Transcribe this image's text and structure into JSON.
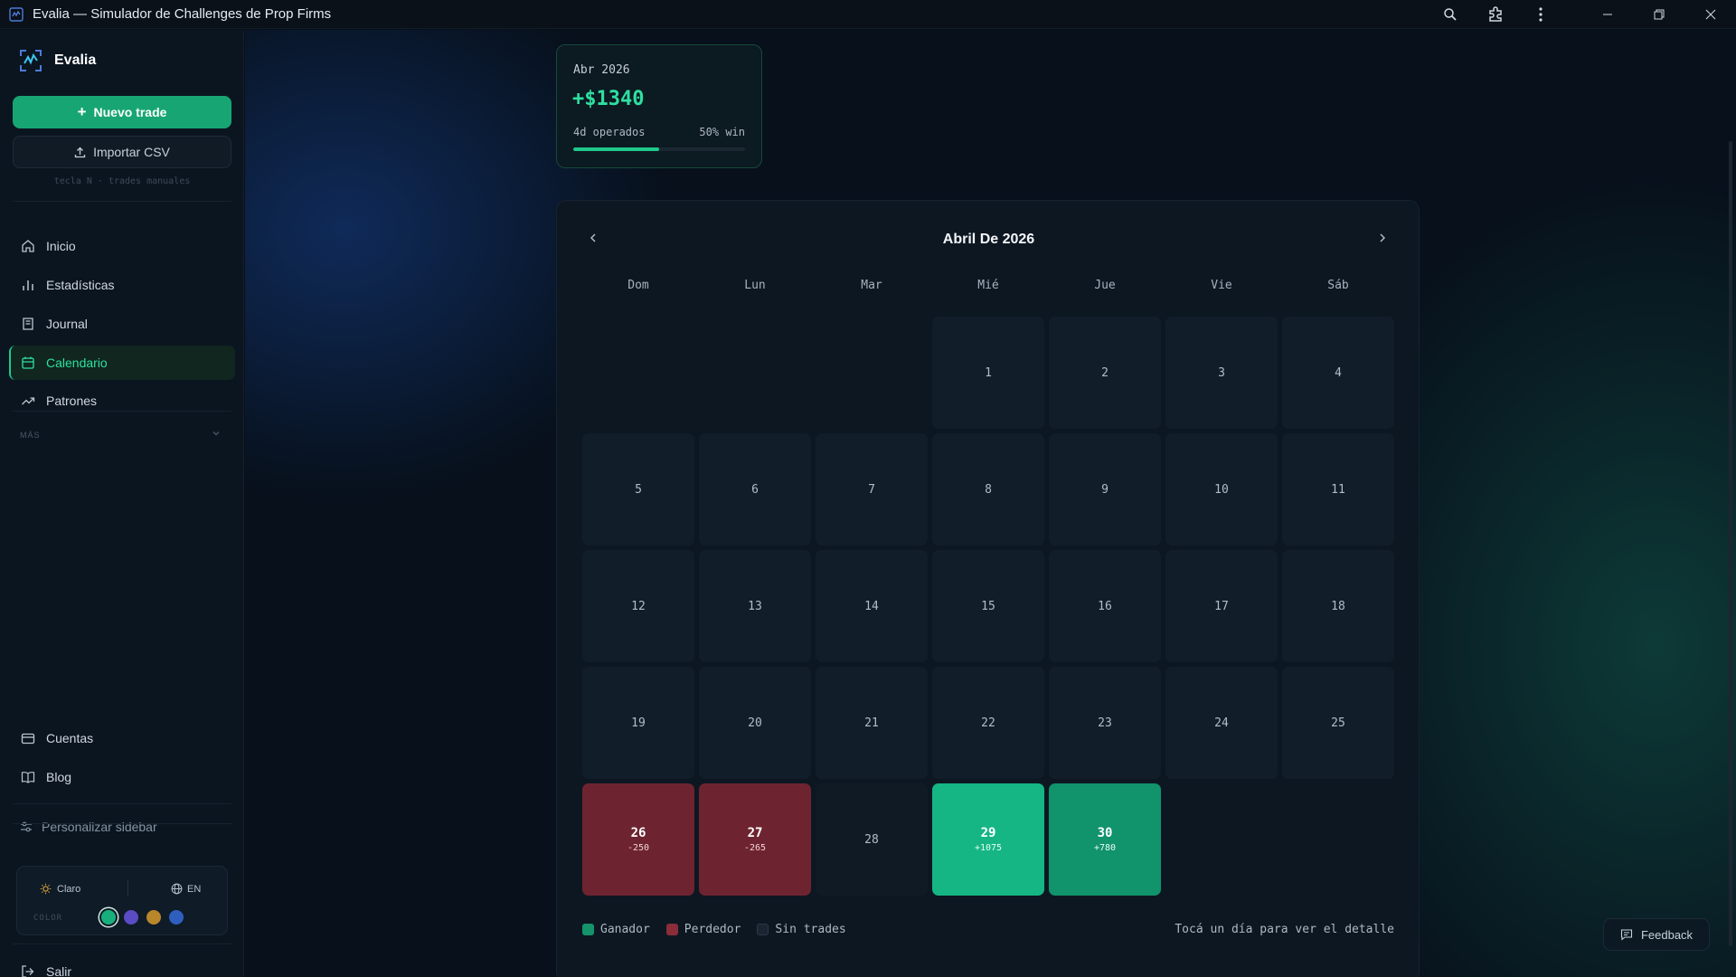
{
  "window": {
    "title": "Evalia — Simulador de Challenges de Prop Firms",
    "icons": [
      "search-icon",
      "extensions-icon",
      "more-vert-icon",
      "minimize-icon",
      "restore-icon",
      "close-icon"
    ]
  },
  "sidebar": {
    "brand": "Evalia",
    "new_trade": "Nuevo trade",
    "import_csv": "Importar CSV",
    "hint": "tecla N · trades manuales",
    "nav": [
      {
        "label": "Inicio",
        "icon": "home-icon"
      },
      {
        "label": "Estadísticas",
        "icon": "bar-chart-icon"
      },
      {
        "label": "Journal",
        "icon": "book-icon"
      },
      {
        "label": "Calendario",
        "icon": "calendar-icon",
        "active": true
      },
      {
        "label": "Patrones",
        "icon": "trending-icon"
      }
    ],
    "more_label": "MÁS",
    "bottom_nav": [
      {
        "label": "Cuentas",
        "icon": "wallet-icon"
      },
      {
        "label": "Blog",
        "icon": "open-book-icon"
      }
    ],
    "customize": "Personalizar sidebar",
    "theme": {
      "mode": "Claro",
      "lang": "EN",
      "color_label": "COLOR",
      "swatches": [
        "#17b07c",
        "#5b4bc4",
        "#b8862b",
        "#2e5fbf"
      ],
      "selected": 0
    },
    "logout": "Salir"
  },
  "summary": {
    "month": "Abr 2026",
    "pnl": "+$1340",
    "days": "4d operados",
    "winrate": "50% win",
    "winrate_value": 0.5
  },
  "calendar": {
    "title": "Abril De 2026",
    "weekdays": [
      "Dom",
      "Lun",
      "Mar",
      "Mié",
      "Jue",
      "Vie",
      "Sáb"
    ],
    "first_weekday": 3,
    "days_in_month": 30,
    "trades": {
      "26": {
        "pnl": "-250",
        "type": "loss"
      },
      "27": {
        "pnl": "-265",
        "type": "loss"
      },
      "29": {
        "pnl": "+1075",
        "type": "win"
      },
      "30": {
        "pnl": "+780",
        "type": "win2"
      }
    },
    "legend": [
      {
        "label": "Ganador",
        "color": "#15936b"
      },
      {
        "label": "Perdedor",
        "color": "#8a2d38"
      },
      {
        "label": "Sin trades",
        "color": "#1a2531"
      }
    ],
    "hint": "Tocá un día para ver el detalle"
  },
  "feedback": "Feedback",
  "colors": {
    "accent": "#1fc98a",
    "loss": "#6e2430",
    "win": "#15b683"
  }
}
